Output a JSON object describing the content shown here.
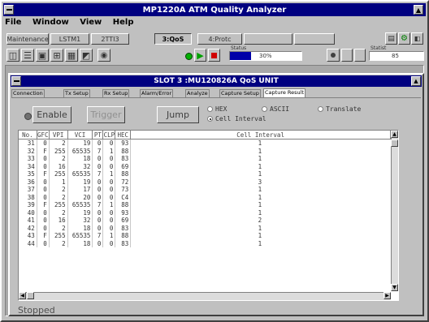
{
  "app": {
    "title": "MP1220A ATM Quality Analyzer"
  },
  "menu": [
    "File",
    "Window",
    "View",
    "Help"
  ],
  "main_tabs": [
    {
      "label": "Maintenance",
      "state": "normal"
    },
    {
      "label": "LSTM1",
      "state": "normal"
    },
    {
      "label": "2TTI3",
      "state": "normal"
    },
    {
      "label": "3:QoS",
      "state": "active"
    },
    {
      "label": "4:Protc",
      "state": "normal"
    },
    {
      "label": "",
      "state": "disabled"
    },
    {
      "label": "",
      "state": "disabled"
    }
  ],
  "toolbar": {
    "gauge1_label": "Status",
    "gauge1_value": "30%",
    "gauge1_fill": 0.3,
    "gauge2_label": "Statist",
    "gauge2_value": "85"
  },
  "child": {
    "title": "SLOT 3 :MU120826A QoS UNIT",
    "tabs": [
      "Connection",
      "Tx Setup",
      "Rx Setup",
      "Alarm/Error",
      "Analyze",
      "Capture Setup",
      "Capture Result"
    ],
    "active_tab": 6,
    "buttons": {
      "enable": "Enable",
      "trigger": "Trigger",
      "jump": "Jump"
    },
    "radios": [
      {
        "label": "HEX",
        "checked": false
      },
      {
        "label": "ASCII",
        "checked": false
      },
      {
        "label": "Translate",
        "checked": false
      },
      {
        "label": "Cell Interval",
        "checked": true
      }
    ],
    "table": {
      "headers": [
        "No.",
        "GFC",
        "VPI",
        "VCI",
        "PT",
        "CLP",
        "HEC",
        "Cell Interval"
      ],
      "rows": [
        [
          "31",
          "0",
          "2",
          "19",
          "0",
          "0",
          "93",
          "1"
        ],
        [
          "32",
          "F",
          "255",
          "65535",
          "7",
          "1",
          "88",
          "1"
        ],
        [
          "33",
          "0",
          "2",
          "18",
          "0",
          "0",
          "83",
          "1"
        ],
        [
          "34",
          "0",
          "16",
          "32",
          "0",
          "0",
          "69",
          "1"
        ],
        [
          "35",
          "F",
          "255",
          "65535",
          "7",
          "1",
          "88",
          "1"
        ],
        [
          "36",
          "0",
          "1",
          "19",
          "0",
          "0",
          "72",
          "3"
        ],
        [
          "37",
          "0",
          "2",
          "17",
          "0",
          "0",
          "73",
          "1"
        ],
        [
          "38",
          "0",
          "2",
          "20",
          "0",
          "0",
          "C4",
          "1"
        ],
        [
          "39",
          "F",
          "255",
          "65535",
          "7",
          "1",
          "88",
          "1"
        ],
        [
          "40",
          "0",
          "2",
          "19",
          "0",
          "0",
          "93",
          "1"
        ],
        [
          "41",
          "0",
          "16",
          "32",
          "0",
          "0",
          "69",
          "2"
        ],
        [
          "42",
          "0",
          "2",
          "18",
          "0",
          "0",
          "83",
          "1"
        ],
        [
          "43",
          "F",
          "255",
          "65535",
          "7",
          "1",
          "88",
          "1"
        ],
        [
          "44",
          "0",
          "2",
          "18",
          "0",
          "0",
          "83",
          "1"
        ]
      ]
    },
    "status": "Stopped"
  },
  "colors": {
    "titlebar": "#000080",
    "gauge": "#0000a8",
    "green": "#00a000",
    "red": "#d00000"
  }
}
